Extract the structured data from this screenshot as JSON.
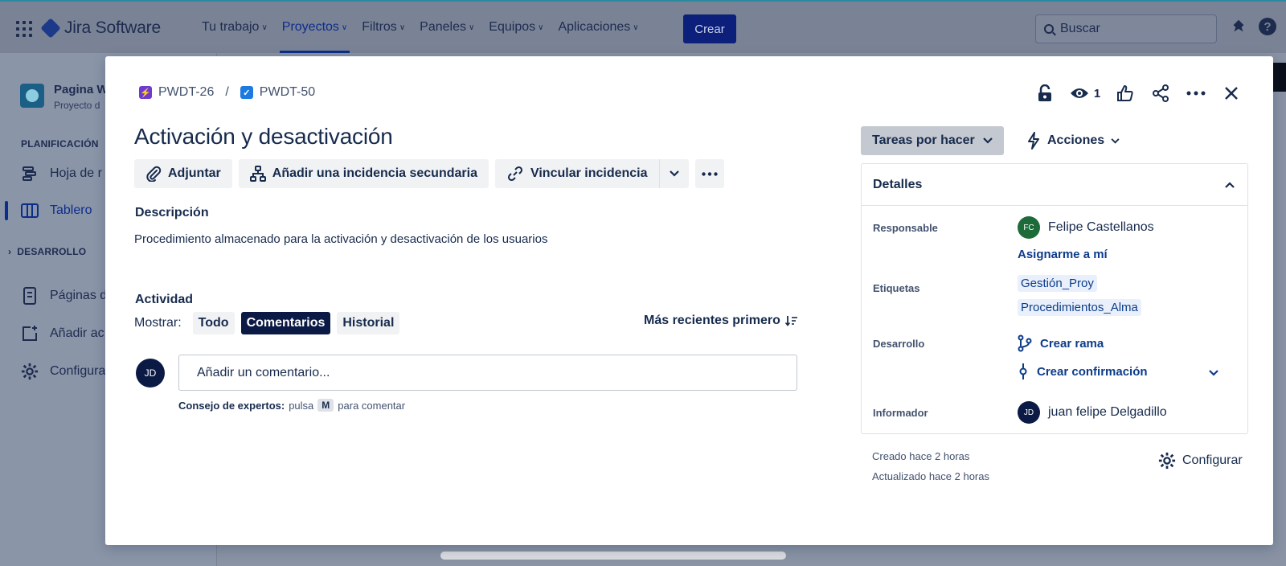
{
  "nav": {
    "app_name": "Jira Software",
    "items": [
      {
        "label": "Tu trabajo"
      },
      {
        "label": "Proyectos"
      },
      {
        "label": "Filtros"
      },
      {
        "label": "Paneles"
      },
      {
        "label": "Equipos"
      },
      {
        "label": "Aplicaciones"
      }
    ],
    "active_item": "Proyectos",
    "create_label": "Crear",
    "search_placeholder": "Buscar"
  },
  "sidebar": {
    "project_name": "Pagina W",
    "project_subtitle": "Proyecto d",
    "section_planning": "PLANIFICACIÓN",
    "item_roadmap": "Hoja de r",
    "item_board": "Tablero",
    "section_dev": "DESARROLLO",
    "item_pages": "Páginas d",
    "item_add": "Añadir ac",
    "item_config": "Configura"
  },
  "issue": {
    "parent_key": "PWDT-26",
    "key": "PWDT-50",
    "watchers": "1",
    "title": "Activación y desactivación",
    "actions": {
      "attach": "Adjuntar",
      "add_child": "Añadir una incidencia secundaria",
      "link": "Vincular incidencia"
    },
    "description_label": "Descripción",
    "description": "Procedimiento almacenado para la activación y desactivación de los usuarios",
    "activity": {
      "label": "Actividad",
      "show_label": "Mostrar:",
      "filters": [
        "Todo",
        "Comentarios",
        "Historial"
      ],
      "selected_filter": "Comentarios",
      "sort_label": "Más recientes primero",
      "user_initials": "JD",
      "comment_placeholder": "Añadir un comentario...",
      "tip_bold": "Consejo de expertos:",
      "tip_press": "pulsa",
      "tip_key": "M",
      "tip_rest": "para comentar"
    }
  },
  "panel": {
    "status": "Tareas por hacer",
    "actions_label": "Acciones",
    "details_title": "Detalles",
    "assignee_label": "Responsable",
    "assignee_initials": "FC",
    "assignee": "Felipe Castellanos",
    "assign_me": "Asignarme a mí",
    "labels_label": "Etiquetas",
    "labels": [
      "Gestión_Proy",
      "Procedimientos_Alma"
    ],
    "dev_label": "Desarrollo",
    "create_branch": "Crear rama",
    "create_commit": "Crear confirmación",
    "reporter_label": "Informador",
    "reporter_initials": "JD",
    "reporter": "juan felipe Delgadillo",
    "created": "Creado hace 2 horas",
    "updated": "Actualizado hace 2 horas",
    "configure": "Configurar"
  },
  "colors": {
    "accent": "#0c2d8a",
    "selected_chip": "#0b1a45",
    "status_bg": "#c4c8d0",
    "epic": "#6e3bd1",
    "task": "#1d7ae0",
    "assignee_avatar": "#1e6b3a"
  }
}
